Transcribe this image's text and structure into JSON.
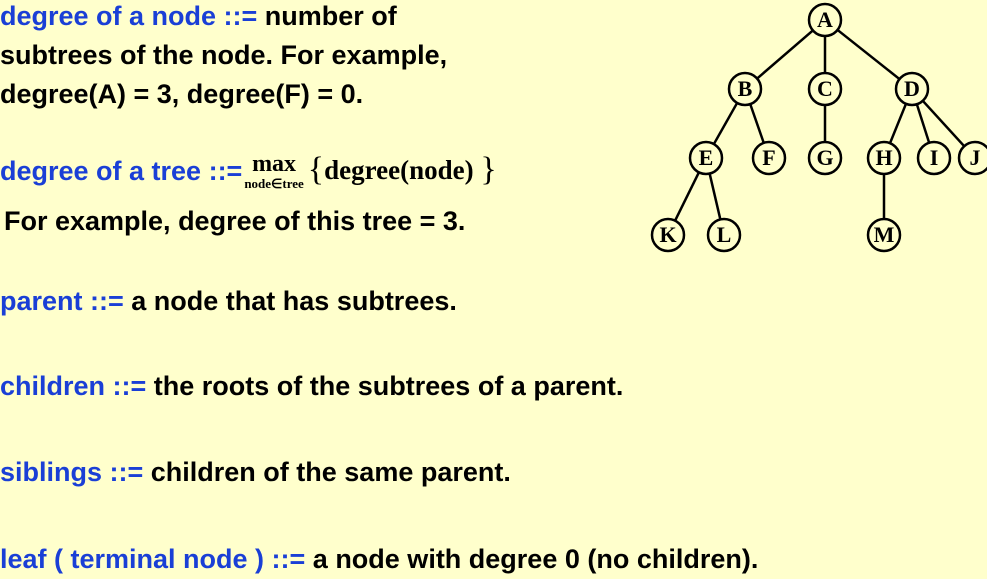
{
  "background": "#ffffcc",
  "keyword_color": "#1a3fd6",
  "definitions": {
    "degree_node": {
      "term": "degree of a node ::=",
      "text_1": " number of",
      "text_2": "subtrees of the node.  For example,",
      "text_3": "degree(A) = 3, degree(F) = 0."
    },
    "degree_tree": {
      "term": "degree of a tree ::=",
      "operator": "max",
      "subscript": "node∈tree",
      "brace_open": "{",
      "argument": "degree(node) ",
      "brace_close": "}",
      "example": "For example, degree of this tree = 3."
    },
    "parent": {
      "term": "parent ::=",
      "text": " a node that has subtrees."
    },
    "children": {
      "term": "children ::=",
      "text": " the roots of the subtrees of a parent."
    },
    "siblings": {
      "term": "siblings ::=",
      "text": " children of the same parent."
    },
    "leaf": {
      "term": "leaf ( terminal node ) ::=",
      "text": " a node with degree 0 (no children)."
    }
  },
  "tree": {
    "nodes": [
      "A",
      "B",
      "C",
      "D",
      "E",
      "F",
      "G",
      "H",
      "I",
      "J",
      "K",
      "L",
      "M"
    ],
    "edges": [
      [
        "A",
        "B"
      ],
      [
        "A",
        "C"
      ],
      [
        "A",
        "D"
      ],
      [
        "B",
        "E"
      ],
      [
        "B",
        "F"
      ],
      [
        "C",
        "G"
      ],
      [
        "D",
        "H"
      ],
      [
        "D",
        "I"
      ],
      [
        "D",
        "J"
      ],
      [
        "E",
        "K"
      ],
      [
        "E",
        "L"
      ],
      [
        "H",
        "M"
      ]
    ]
  }
}
